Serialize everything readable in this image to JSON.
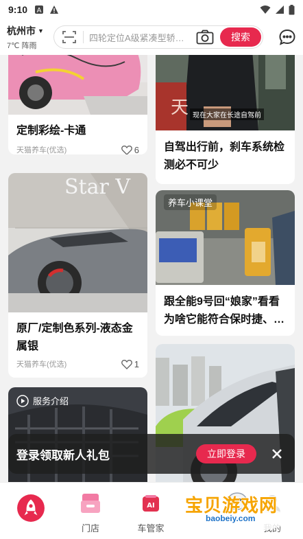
{
  "status": {
    "time": "9:10"
  },
  "header": {
    "city": "杭州市",
    "weather": "7℃ 阵雨",
    "search_placeholder": "四轮定位A级紧凑型轿…",
    "search_button": "搜索"
  },
  "feed": {
    "left": [
      {
        "title": "定制彩绘-卡通",
        "shop": "天猫养车(优选)",
        "likes": "6"
      },
      {
        "title": "原厂/定制色系列-液态金属银",
        "shop": "天猫养车(优选)",
        "likes": "1",
        "image_text": "Star V"
      },
      {
        "tag": "服务介绍"
      }
    ],
    "right": [
      {
        "title": "自驾出行前，刹车系统检测必不可少",
        "caption": "现在大家在长途自驾前"
      },
      {
        "title": "跟全能9号回“娘家”看看为啥它能符合保时捷、…",
        "tag": "养车小课堂"
      },
      {
        "title": ""
      }
    ]
  },
  "banner": {
    "text": "登录领取新人礼包",
    "button": "立即登录"
  },
  "nav": {
    "items": [
      {
        "label": ""
      },
      {
        "label": "门店"
      },
      {
        "label": "车管家"
      },
      {
        "label": "我的"
      }
    ]
  },
  "watermark": {
    "text": "宝贝游戏网",
    "url": "baobeiy.com"
  },
  "colors": {
    "accent": "#e7294e"
  }
}
